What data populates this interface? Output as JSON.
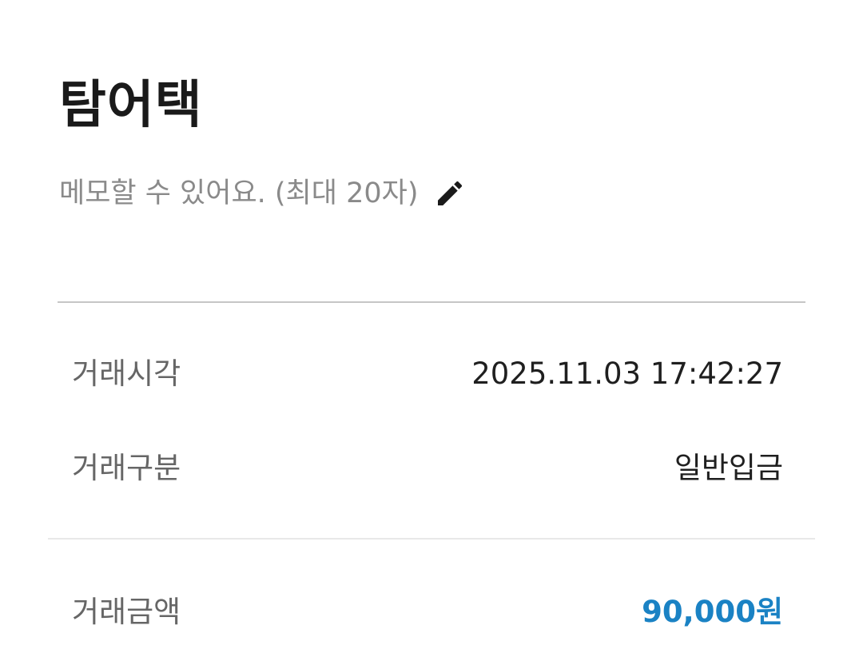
{
  "header": {
    "title": "탐어택",
    "memo_placeholder": "메모할 수 있어요. (최대 20자)",
    "memo_edit_icon": "pencil-icon"
  },
  "details": {
    "rows": [
      {
        "label": "거래시각",
        "value": "2025.11.03 17:42:27"
      },
      {
        "label": "거래구분",
        "value": "일반입금"
      }
    ],
    "amount": {
      "label": "거래금액",
      "value": "90,000원"
    }
  },
  "colors": {
    "amount": "#1a82c4",
    "label": "#666666",
    "placeholder": "#8a8a8a"
  }
}
